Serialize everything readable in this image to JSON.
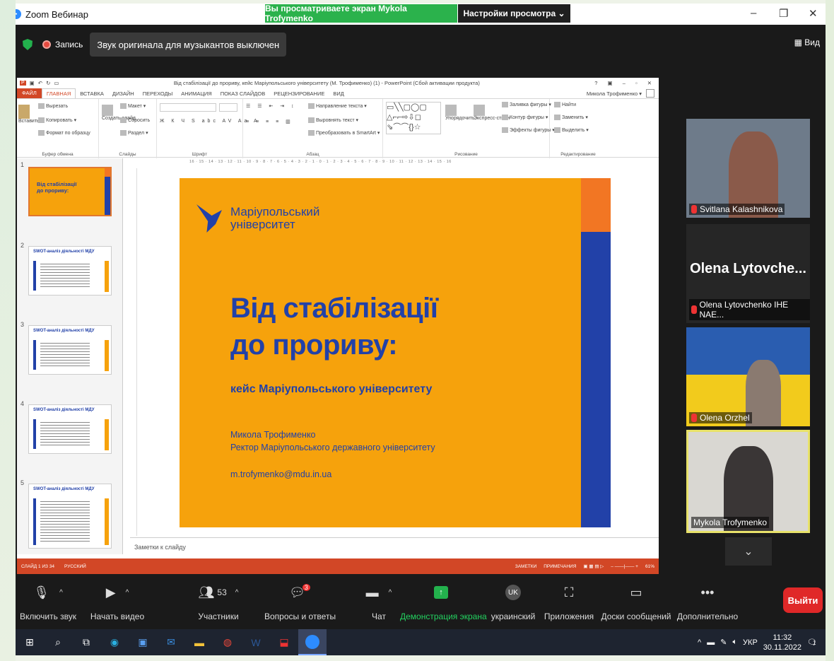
{
  "zoom": {
    "window_title": "Zoom Вебинар",
    "share_banner": "Вы просматриваете экран Mykola Trofymenko",
    "view_options": "Настройки просмотра ⌄",
    "record_label": "Запись",
    "original_sound": "Звук оригинала для музыкантов выключен",
    "view_label": "Вид"
  },
  "ppt": {
    "doc_title": "Від стабілізації до прориву, кейс Маріупольського університету (М. Трофименко) (1) - PowerPoint (Сбой активации продукта)",
    "user": "Микола Трофименко ▾",
    "tabs": [
      "ФАЙЛ",
      "ГЛАВНАЯ",
      "ВСТАВКА",
      "ДИЗАЙН",
      "ПЕРЕХОДЫ",
      "АНИМАЦИЯ",
      "ПОКАЗ СЛАЙДОВ",
      "РЕЦЕНЗИРОВАНИЕ",
      "ВИД"
    ],
    "ribbon": {
      "cut": "Вырезать",
      "copy": "Копировать",
      "format_painter": "Формат по образцу",
      "paste": "Вставить",
      "clipboard": "Буфер обмена",
      "new_slide": "Создать слайд",
      "layout": "Макет",
      "reset": "Сбросить",
      "section": "Раздел",
      "slides": "Слайды",
      "font": "Шрифт",
      "paragraph": "Абзац",
      "text_dir": "Направление текста",
      "align_text": "Выровнять текст",
      "smartart": "Преобразовать в SmartArt",
      "arrange": "Упорядочить",
      "quick_styles": "Экспресс-стили",
      "fill": "Заливка фигуры",
      "outline": "Контур фигуры",
      "effects": "Эффекты фигуры",
      "drawing": "Рисование",
      "find": "Найти",
      "replace": "Заменить",
      "select": "Выделить",
      "editing": "Редактирование"
    },
    "ruler": "16 · 15 · 14 · 13 · 12 · 11 · 10 · 9 · 8 · 7 · 6 · 5 · 4 · 3 · 2 · 1 · 0 · 1 · 2 · 3 · 4 · 5 · 6 · 7 · 8 · 9 · 10 · 11 · 12 · 13 · 14 · 15 · 16",
    "thumbs": [
      {
        "num": "1",
        "title": "Від стабілізації до прориву:"
      },
      {
        "num": "2",
        "title": "SWOT-аналіз діяльності МДУ"
      },
      {
        "num": "3",
        "title": "SWOT-аналіз діяльності МДУ"
      },
      {
        "num": "4",
        "title": "SWOT-аналіз діяльності МДУ"
      },
      {
        "num": "5",
        "title": "SWOT-аналіз діяльності МДУ"
      }
    ],
    "notes": "Заметки к слайду",
    "status_left": "СЛАЙД 1 ИЗ 34",
    "status_lang": "РУССКИЙ",
    "status_notes": "ЗАМЕТКИ",
    "status_comments": "ПРИМЕЧАНИЯ",
    "zoom_pct": "61%"
  },
  "slide": {
    "uni_line1": "Маріупольський",
    "uni_line2": "університет",
    "title_line1": "Від стабілізації",
    "title_line2": "до прориву:",
    "subtitle": "кейс Маріупольського університету",
    "author": "Микола Трофименко",
    "position": "Ректор Маріупольського державного університету",
    "email": "m.trofymenko@mdu.in.ua"
  },
  "participants": [
    {
      "name": "Svitlana Kalashnikova"
    },
    {
      "name": "Olena Lytovchenko IHE NAE...",
      "big_name": "Olena  Lytovche..."
    },
    {
      "name": "Olena Orzhel"
    },
    {
      "name": "Mykola Trofymenko"
    }
  ],
  "controls": {
    "mute": "Включить звук",
    "video": "Начать видео",
    "participants": "Участники",
    "participants_count": "53",
    "qa": "Вопросы и ответы",
    "qa_badge": "3",
    "chat": "Чат",
    "share": "Демонстрация экрана",
    "lang": "украинский",
    "lang_code": "UK",
    "apps": "Приложения",
    "whiteboards": "Доски сообщений",
    "more": "Дополнительно",
    "leave": "Выйти"
  },
  "taskbar": {
    "lang": "УКР",
    "time": "11:32",
    "date": "30.11.2022",
    "notif": "1"
  }
}
